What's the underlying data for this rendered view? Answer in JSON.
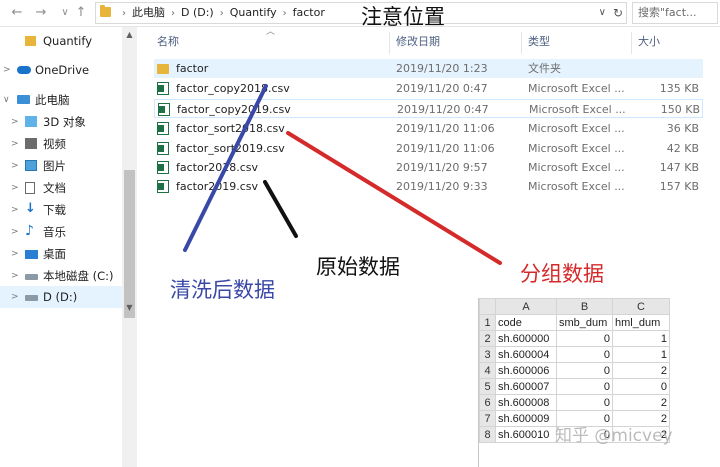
{
  "nav": {
    "back_icon": "back-arrow-icon",
    "forward_icon": "forward-arrow-icon",
    "up_icon": "up-arrow-icon",
    "back": "←",
    "forward": "→",
    "up": "↑"
  },
  "address": {
    "crumbs": [
      "此电脑",
      "D (D:)",
      "Quantify",
      "factor"
    ],
    "separator": "›",
    "dropdown": "∨",
    "refresh": "↻"
  },
  "search": {
    "placeholder": "搜索\"fact..."
  },
  "sidebar": {
    "items": [
      {
        "label": "Quantify",
        "icon": "folder-icon"
      },
      {
        "label": "OneDrive",
        "icon": "cloud-icon"
      },
      {
        "label": "此电脑",
        "icon": "computer-icon"
      },
      {
        "label": "3D 对象",
        "icon": "cube-icon"
      },
      {
        "label": "视频",
        "icon": "video-icon"
      },
      {
        "label": "图片",
        "icon": "picture-icon"
      },
      {
        "label": "文档",
        "icon": "document-icon"
      },
      {
        "label": "下载",
        "icon": "download-icon"
      },
      {
        "label": "音乐",
        "icon": "music-icon"
      },
      {
        "label": "桌面",
        "icon": "desktop-icon"
      },
      {
        "label": "本地磁盘 (C:)",
        "icon": "drive-icon"
      },
      {
        "label": "D (D:)",
        "icon": "drive-icon"
      }
    ]
  },
  "columns": {
    "name": "名称",
    "modified": "修改日期",
    "type": "类型",
    "size": "大小"
  },
  "files": [
    {
      "name": "factor",
      "modified": "2019/11/20 1:23",
      "type": "文件夹",
      "size": "",
      "kind": "folder"
    },
    {
      "name": "factor_copy2018.csv",
      "modified": "2019/11/20 0:47",
      "type": "Microsoft Excel ...",
      "size": "135 KB",
      "kind": "excel"
    },
    {
      "name": "factor_copy2019.csv",
      "modified": "2019/11/20 0:47",
      "type": "Microsoft Excel ...",
      "size": "150 KB",
      "kind": "excel"
    },
    {
      "name": "factor_sort2018.csv",
      "modified": "2019/11/20 11:06",
      "type": "Microsoft Excel ...",
      "size": "36 KB",
      "kind": "excel"
    },
    {
      "name": "factor_sort2019.csv",
      "modified": "2019/11/20 11:06",
      "type": "Microsoft Excel ...",
      "size": "42 KB",
      "kind": "excel"
    },
    {
      "name": "factor2018.csv",
      "modified": "2019/11/20 9:57",
      "type": "Microsoft Excel ...",
      "size": "147 KB",
      "kind": "excel"
    },
    {
      "name": "factor2019.csv",
      "modified": "2019/11/20 9:33",
      "type": "Microsoft Excel ...",
      "size": "157 KB",
      "kind": "excel"
    }
  ],
  "annotations": {
    "title": "注意位置",
    "cleaned": "清洗后数据",
    "raw": "原始数据",
    "grouped": "分组数据",
    "colors": {
      "blue": "#3a48a8",
      "black": "#111111",
      "red": "#d42a2a"
    }
  },
  "sheet": {
    "col_headers": [
      "A",
      "B",
      "C"
    ],
    "row_headers": [
      "1",
      "2",
      "3",
      "4",
      "5",
      "6",
      "7",
      "8"
    ],
    "rows": [
      [
        "code",
        "smb_dum",
        "hml_dum"
      ],
      [
        "sh.600000",
        "0",
        "1"
      ],
      [
        "sh.600004",
        "0",
        "1"
      ],
      [
        "sh.600006",
        "0",
        "2"
      ],
      [
        "sh.600007",
        "0",
        "0"
      ],
      [
        "sh.600008",
        "0",
        "2"
      ],
      [
        "sh.600009",
        "0",
        "2"
      ],
      [
        "sh.600010",
        "0",
        "2"
      ]
    ]
  },
  "watermark": "知乎 @micvey"
}
